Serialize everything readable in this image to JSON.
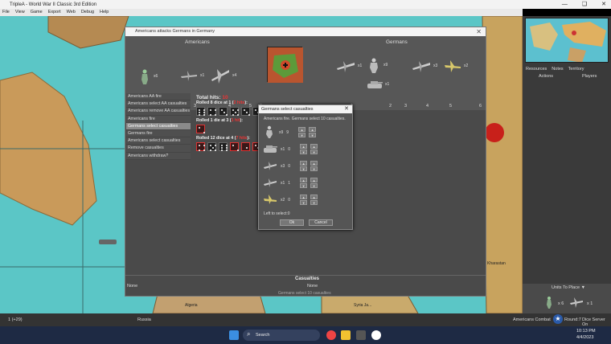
{
  "window": {
    "title": "TripleA - World War II Classic 3rd Edition",
    "controls": [
      "—",
      "❑",
      "✕"
    ]
  },
  "menu": [
    "File",
    "View",
    "Game",
    "Export",
    "Web",
    "Debug",
    "Help"
  ],
  "right_panel": {
    "tabs_top": [
      "Resources",
      "Notes",
      "Territory"
    ],
    "tabs_bottom": [
      "Actions",
      "Players"
    ],
    "units_to_place": "Units To Place ▼",
    "place_counts": [
      "x 6",
      "x 1"
    ]
  },
  "battle": {
    "title": "Americans attacks Germans in Germany",
    "attacker": "Americans",
    "defender": "Germans",
    "attacker_units": [
      {
        "icon": "infantry-icon",
        "count": "x6"
      },
      {
        "icon": "fighter-icon",
        "count": "x1"
      },
      {
        "icon": "bomber-icon",
        "count": "x4"
      }
    ],
    "defender_units": [
      {
        "icon": "fighter-icon",
        "count": "x1"
      },
      {
        "icon": "infantry-icon",
        "count": "x9"
      },
      {
        "icon": "tank-icon",
        "count": "x1"
      },
      {
        "icon": "fighter-icon",
        "count": "x3"
      },
      {
        "icon": "bomber-icon",
        "count": "x2"
      }
    ],
    "attacker_numbers": [
      "1",
      "2",
      "3",
      "4",
      "5",
      "6"
    ],
    "defender_numbers": [
      "1",
      "2",
      "3",
      "4",
      "5",
      "6"
    ],
    "steps": [
      "Americans AA fire",
      "Americans select AA casualties",
      "Americans remove AA casualties",
      "Americans fire",
      "Germans select casualties",
      "Germans fire",
      "Americans select casualties",
      "Remove casualties",
      "Americans withdraw?"
    ],
    "selected_step": 4,
    "total_hits_label": "Total hits:",
    "total_hits": "10",
    "rolls": [
      {
        "label": "Rolled 8 dice at 1 (",
        "hits": "2 hits",
        "end": "):",
        "dice": [
          6,
          4,
          3,
          5,
          3,
          3,
          1,
          6
        ]
      },
      {
        "label": "Rolled 1 die at 3 (",
        "hits": "1 hit",
        "end": "):",
        "dice": [
          2
        ]
      },
      {
        "label": "Rolled 12 dice at 4 (",
        "hits": "7 hits",
        "end": "):",
        "dice": [
          4,
          5,
          6,
          2,
          1,
          3,
          4,
          2,
          1,
          3,
          4,
          5
        ]
      }
    ],
    "casualties_header": "Casualties",
    "casualties_left": "None",
    "casualties_right": "None",
    "footer_status": "Germans select 10 casualties"
  },
  "casualty_dialog": {
    "title": "Germans select casualties",
    "message": "Americans fire.  Germans select 10 casualties.",
    "rows": [
      {
        "icon": "infantry-icon",
        "count": "x9",
        "selected": "9"
      },
      {
        "icon": "tank-icon",
        "count": "x1",
        "selected": "0"
      },
      {
        "icon": "fighter-icon",
        "count": "x3",
        "selected": "0"
      },
      {
        "icon": "fighter-icon",
        "count": "x1",
        "selected": "1"
      },
      {
        "icon": "bomber-icon",
        "count": "x2",
        "selected": "0"
      }
    ],
    "left_to_select": "Left to select:0",
    "ok": "Ok",
    "cancel": "Cancel"
  },
  "map_labels": [
    "Russia",
    "Algeria",
    "Syria Ja...",
    "Kharastan"
  ],
  "statusbar": {
    "left": "1 (+29)",
    "territory": "Russia",
    "phase": "Americans Combat",
    "round": "Round:7",
    "dice": "Dice Server On"
  },
  "taskbar": {
    "search": "Search",
    "time": "10:13 PM",
    "date": "4/4/2023"
  }
}
